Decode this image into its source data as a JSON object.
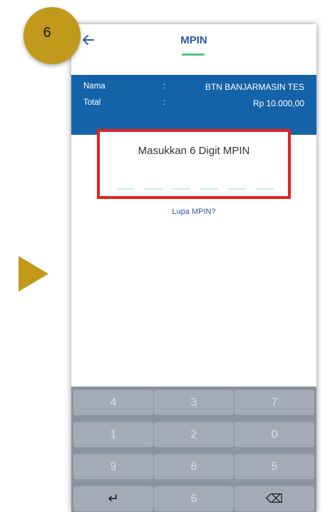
{
  "step": {
    "number": "6"
  },
  "header": {
    "title": "MPIN",
    "back_icon": "arrow-left-icon"
  },
  "info": {
    "rows": [
      {
        "label": "Nama",
        "sep": ":",
        "value": "BTN BANJARMASIN TES"
      },
      {
        "label": "Total",
        "sep": ":",
        "value": "Rp 10.000,00"
      }
    ]
  },
  "pin": {
    "prompt": "Masukkan 6 Digit MPIN",
    "digits_entered": 0,
    "length": 6
  },
  "forgot": {
    "label": "Lupa MPIN?"
  },
  "keypad": {
    "rows": [
      [
        "4",
        "3",
        "7"
      ],
      [
        "1",
        "2",
        "0"
      ],
      [
        "9",
        "8",
        "5"
      ],
      [
        "↵",
        "6",
        "⌫"
      ]
    ]
  },
  "colors": {
    "accent_gold": "#c19a1b",
    "primary_blue": "#1463a9",
    "highlight_red": "#e5201d",
    "underline_green": "#56c37a"
  }
}
